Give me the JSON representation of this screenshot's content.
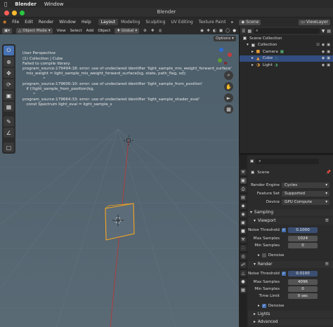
{
  "mac_menu": {
    "apple": "",
    "app": "Blender",
    "window": "Window"
  },
  "window_title": "Blender",
  "menus": [
    "File",
    "Edit",
    "Render",
    "Window",
    "Help"
  ],
  "workspaces": [
    "Layout",
    "Modeling",
    "Sculpting",
    "UV Editing",
    "Texture Paint"
  ],
  "scene": "Scene",
  "view_layer": "ViewLayer",
  "viewport_header": {
    "mode": "Object Mode",
    "menus": [
      "View",
      "Select",
      "Add",
      "Object"
    ],
    "transform": "Global",
    "options": "Options"
  },
  "overlay_text": {
    "lines": [
      "User Perspective",
      "(1) Collection | Cube",
      "Failed to compile library:",
      "program_source:179494:18: error: use of undeclared identifier 'light_sample_mis_weight_forward_surface'",
      "   mis_weight = light_sample_mis_weight_forward_surface(kg, state, path_flag, sd);",
      "                ^",
      "program_source:179600:10: error: use of undeclared identifier 'light_sample_from_position'",
      "   if (!light_sample_from_position(kg,",
      "        ^",
      "program_source:179664:33: error: use of undeclared identifier 'light_sample_shader_eval'",
      "   const Spectrum light_eval = light_sample_s"
    ]
  },
  "outliner": {
    "items": [
      {
        "label": "Scene Collection",
        "icon": "collection-icon",
        "indent": 0
      },
      {
        "label": "Collection",
        "icon": "collection-icon",
        "indent": 1
      },
      {
        "label": "Camera",
        "icon": "camera-icon",
        "indent": 2
      },
      {
        "label": "Cube",
        "icon": "cube-icon",
        "indent": 2,
        "selected": true
      },
      {
        "label": "Light",
        "icon": "light-icon",
        "indent": 2
      }
    ]
  },
  "properties": {
    "scene_name": "Scene",
    "render_engine_label": "Render Engine",
    "render_engine": "Cycles",
    "feature_set_label": "Feature Set",
    "feature_set": "Supported",
    "device_label": "Device",
    "device": "GPU Compute",
    "sampling": "Sampling",
    "viewport": "Viewport",
    "vp_noise_label": "Noise Threshold",
    "vp_noise": "0.1000",
    "vp_max_label": "Max Samples",
    "vp_max": "1024",
    "vp_min_label": "Min Samples",
    "vp_min": "0",
    "vp_denoise": "Denoise",
    "render": "Render",
    "r_noise_label": "Noise Threshold",
    "r_noise": "0.0100",
    "r_max_label": "Max Samples",
    "r_max": "4096",
    "r_min_label": "Min Samples",
    "r_min": "0",
    "r_time_label": "Time Limit",
    "r_time": "0 sec",
    "r_denoise": "Denoise",
    "lights": "Lights",
    "advanced": "Advanced"
  },
  "colors": {
    "accent": "#4772b3",
    "selection_outline": "#f5a623",
    "x_axis": "#b23a3a"
  }
}
